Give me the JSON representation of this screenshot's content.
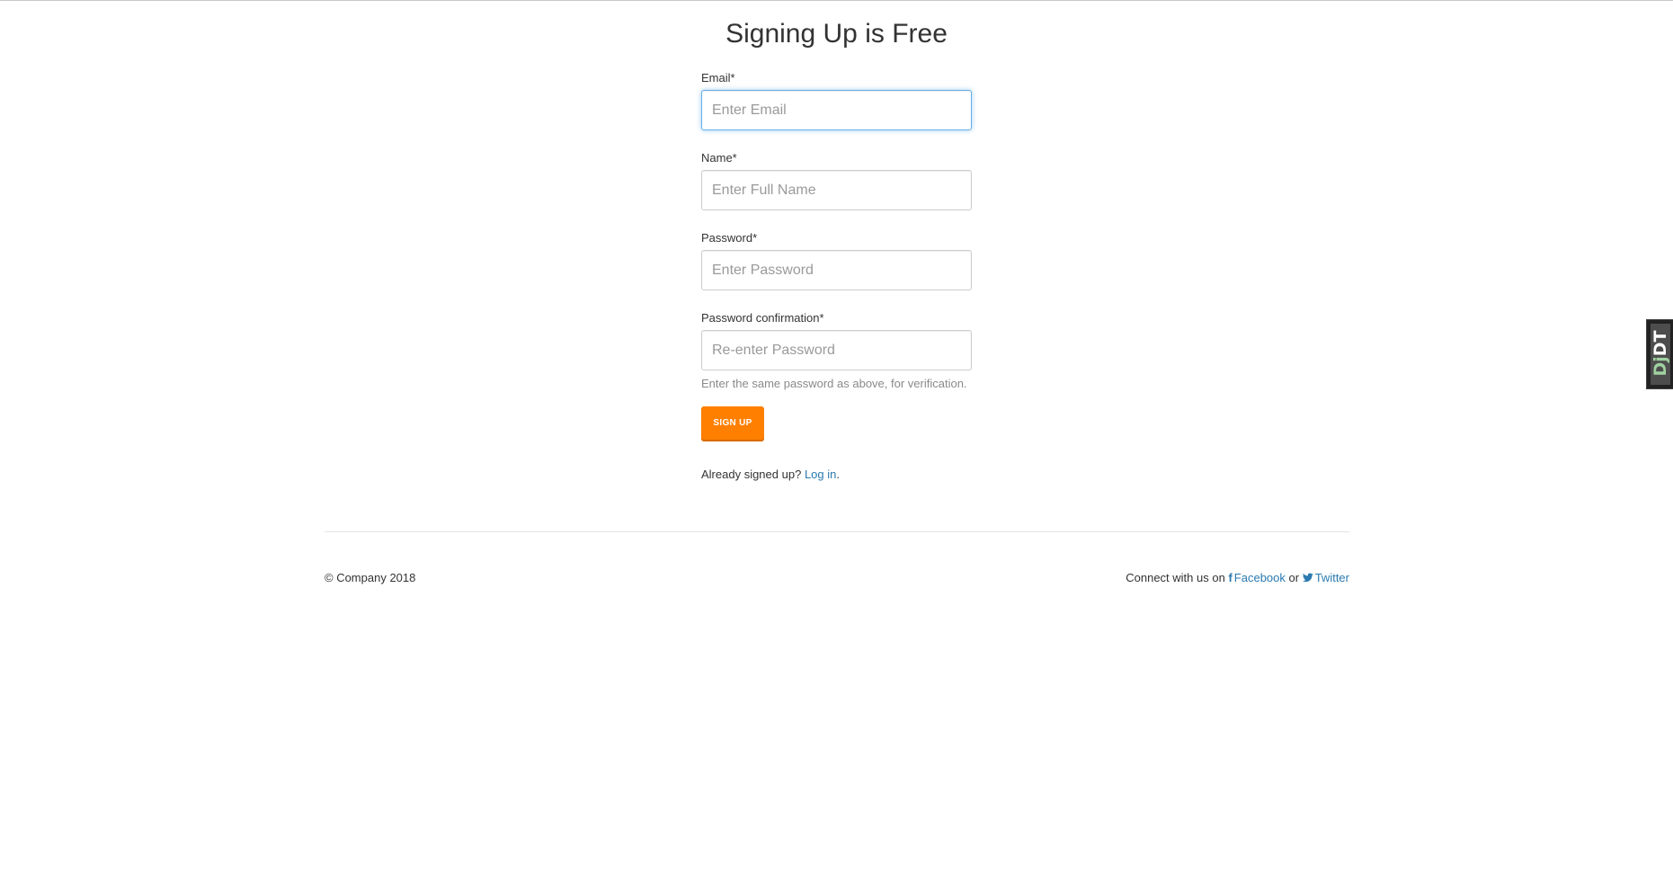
{
  "page": {
    "title": "Signing Up is Free"
  },
  "form": {
    "email": {
      "label": "Email*",
      "placeholder": "Enter Email",
      "value": ""
    },
    "name": {
      "label": "Name*",
      "placeholder": "Enter Full Name",
      "value": ""
    },
    "password": {
      "label": "Password*",
      "placeholder": "Enter Password",
      "value": ""
    },
    "password_confirmation": {
      "label": "Password confirmation*",
      "placeholder": "Re-enter Password",
      "value": "",
      "help": "Enter the same password as above, for verification."
    },
    "submit_label": "SIGN UP"
  },
  "login_prompt": {
    "text": "Already signed up?",
    "link_label": "Log in",
    "suffix": "."
  },
  "footer": {
    "copyright": "© Company 2018",
    "connect_text": "Connect with us on",
    "facebook_icon": "f",
    "facebook_label": "Facebook",
    "or_text": "or",
    "twitter_icon": "🐦",
    "twitter_label": "Twitter"
  },
  "debug_toolbar": {
    "handle_label_start": "Dj",
    "handle_label_end": "DT"
  },
  "colors": {
    "accent_button": "#ff7f00",
    "link": "#2a7ab0",
    "focus_border": "#66afe9"
  },
  "icons": {
    "facebook": "facebook-icon",
    "twitter": "twitter-icon"
  }
}
